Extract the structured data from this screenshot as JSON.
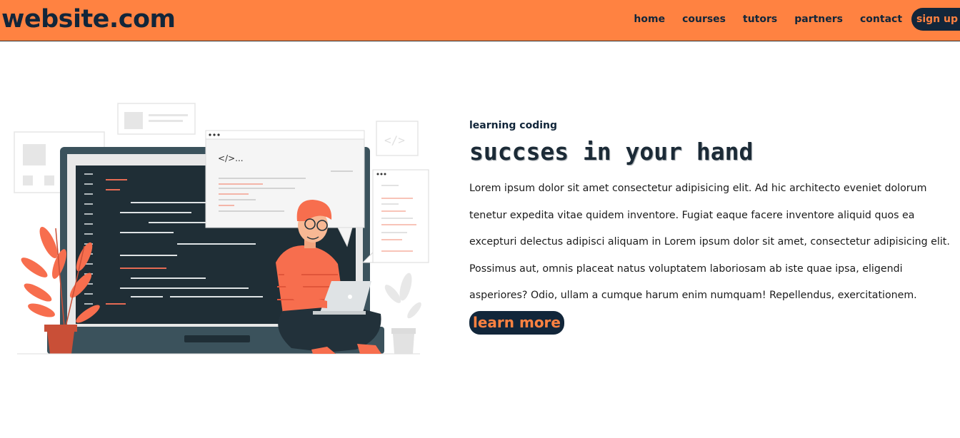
{
  "header": {
    "logo": "website.com",
    "nav": [
      "home",
      "courses",
      "tutors",
      "partners",
      "contact"
    ],
    "signup_label": "sign up"
  },
  "hero": {
    "eyebrow": "learning coding",
    "headline": "succses in your hand",
    "body": "Lorem ipsum dolor sit amet consectetur adipisicing elit. Ad hic architecto eveniet dolorum tenetur expedita vitae quidem inventore. Fugiat eaque facere inventore aliquid quos ea excepturi delectus adipisci aliquam in Lorem ipsum dolor sit amet, consectetur adipisicing elit. Possimus aut, omnis placeat natus voluptatem laboriosam ab iste quae ipsa, eligendi asperiores? Odio, ullam a cumque harum enim numquam! Repellendus, exercitationem.",
    "cta_label": "learn more",
    "illustration": {
      "code_bubble_text": "</>...",
      "code_icon_text": "</>"
    }
  },
  "colors": {
    "accent": "#ff8241",
    "dark": "#12263a",
    "screen": "#1f2e36",
    "coral": "#f76e4e"
  }
}
